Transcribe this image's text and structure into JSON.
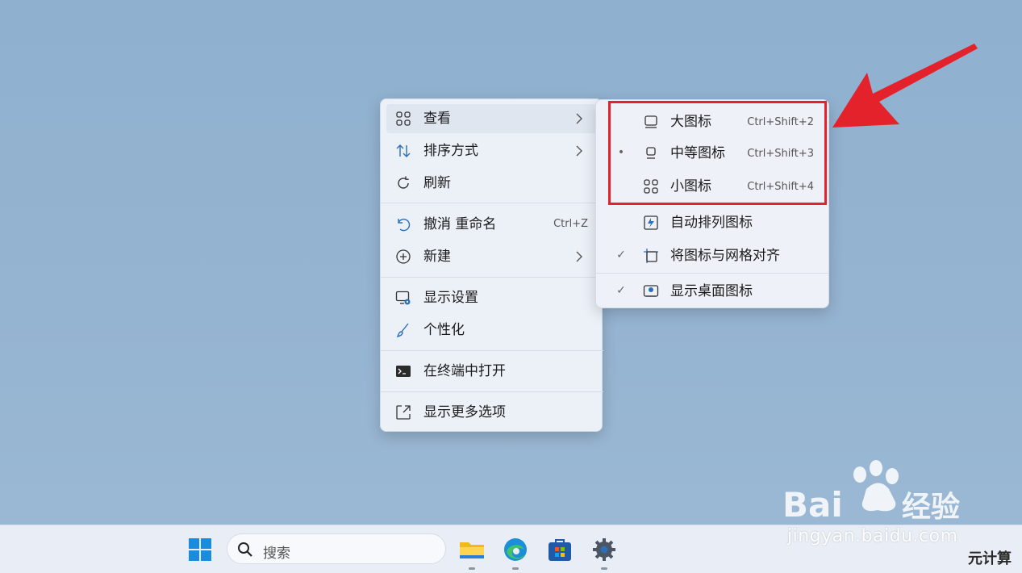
{
  "context_menu": {
    "items": [
      {
        "label": "查看",
        "icon": "grid-icon",
        "has_submenu": true
      },
      {
        "label": "排序方式",
        "icon": "sort-icon",
        "has_submenu": true
      },
      {
        "label": "刷新",
        "icon": "refresh-icon"
      },
      {
        "label": "撤消 重命名",
        "icon": "undo-icon",
        "shortcut": "Ctrl+Z"
      },
      {
        "label": "新建",
        "icon": "add-circle-icon",
        "has_submenu": true
      },
      {
        "label": "显示设置",
        "icon": "display-settings-icon"
      },
      {
        "label": "个性化",
        "icon": "brush-icon"
      },
      {
        "label": "在终端中打开",
        "icon": "terminal-icon"
      },
      {
        "label": "显示更多选项",
        "icon": "open-external-icon"
      }
    ]
  },
  "view_submenu": {
    "items": [
      {
        "label": "大图标",
        "shortcut": "Ctrl+Shift+2",
        "icon": "large-icon-icon",
        "mark": ""
      },
      {
        "label": "中等图标",
        "shortcut": "Ctrl+Shift+3",
        "icon": "medium-icon-icon",
        "mark": "•"
      },
      {
        "label": "小图标",
        "shortcut": "Ctrl+Shift+4",
        "icon": "small-icons-icon",
        "mark": ""
      },
      {
        "label": "自动排列图标",
        "icon": "auto-arrange-icon",
        "mark": ""
      },
      {
        "label": "将图标与网格对齐",
        "icon": "align-grid-icon",
        "mark": "✓"
      },
      {
        "label": "显示桌面图标",
        "icon": "show-desktop-icon",
        "mark": "✓"
      }
    ]
  },
  "taskbar": {
    "search_placeholder": "搜索",
    "apps": [
      "start-icon",
      "file-explorer-icon",
      "edge-icon",
      "store-icon",
      "settings-icon"
    ]
  },
  "watermark": {
    "brand": "Bai du 经验",
    "url": "jingyan.baidu.com",
    "corner": "元计算"
  },
  "colors": {
    "highlight_border": "#e4222b",
    "arrow": "#e4222b",
    "desktop": "#93b2cf",
    "menu_bg": "#ecf1f8"
  }
}
